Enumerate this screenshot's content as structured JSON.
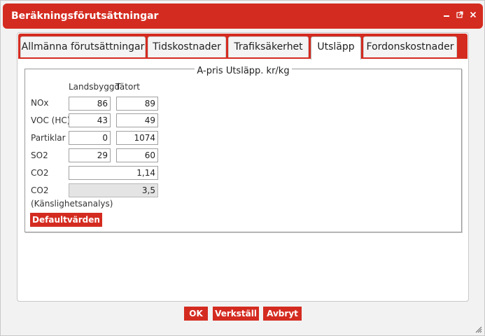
{
  "window": {
    "title": "Beräkningsförutsättningar",
    "icons": [
      "minimize-icon",
      "popout-icon",
      "close-icon"
    ]
  },
  "tabs": [
    {
      "label": "Allmänna förutsättningar",
      "active": false
    },
    {
      "label": "Tidskostnader",
      "active": false
    },
    {
      "label": "Trafiksäkerhet",
      "active": false
    },
    {
      "label": "Utsläpp",
      "active": true
    },
    {
      "label": "Fordonskostnader",
      "active": false
    }
  ],
  "section": {
    "legend": "A-pris Utsläpp. kr/kg",
    "columns": {
      "landsbygd": "Landsbyggd",
      "tatort": "Tätort"
    },
    "rows": [
      {
        "label": "NOx",
        "landsbygd": "86",
        "tatort": "89"
      },
      {
        "label": "VOC (HC)",
        "landsbygd": "43",
        "tatort": "49"
      },
      {
        "label": "Partiklar",
        "landsbygd": "0",
        "tatort": "1074"
      },
      {
        "label": "SO2",
        "landsbygd": "29",
        "tatort": "60"
      }
    ],
    "co2": {
      "label": "CO2",
      "value": "1,14"
    },
    "co2_sens": {
      "label_line1": "CO2",
      "label_line2": "(Känslighetsanalys)",
      "value": "3,5"
    },
    "default_button": "Defaultvärden"
  },
  "footer": {
    "ok": "OK",
    "apply": "Verkställ",
    "cancel": "Avbryt"
  },
  "colors": {
    "accent": "#d42b20"
  }
}
